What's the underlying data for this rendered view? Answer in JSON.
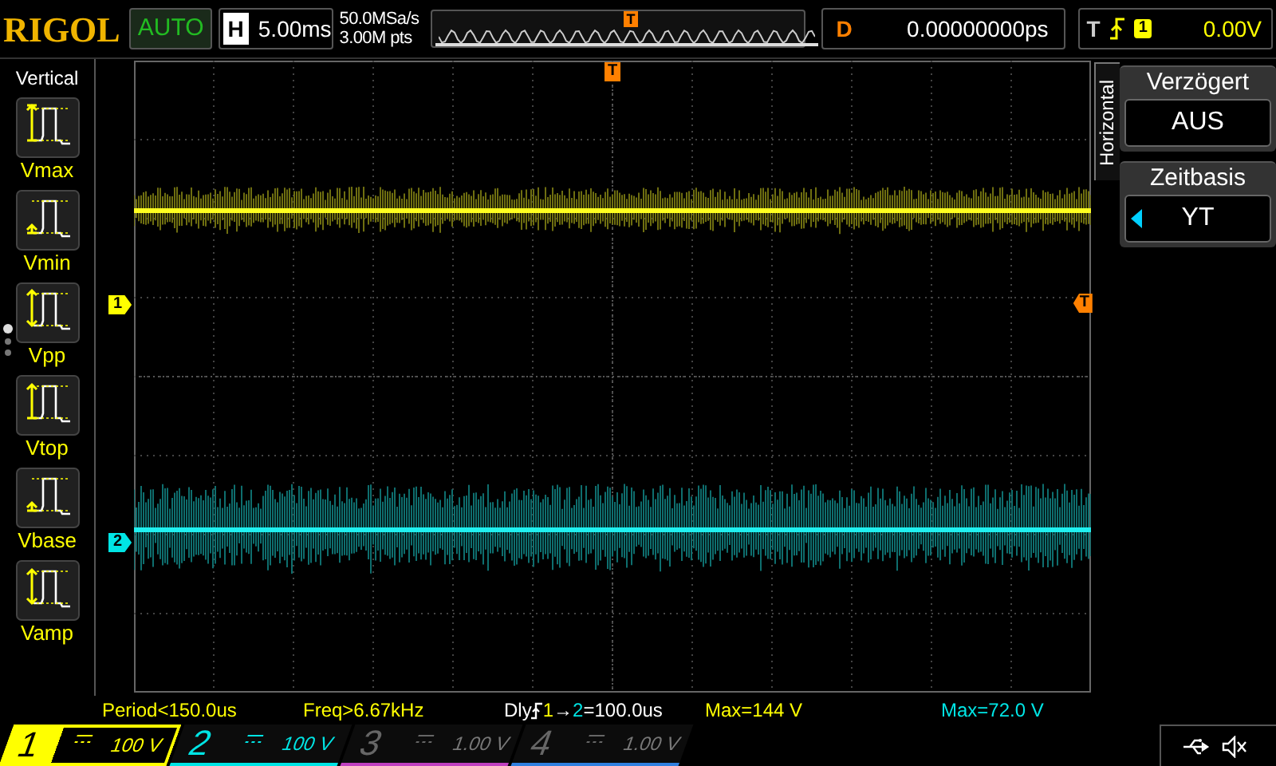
{
  "header": {
    "logo": "RIGOL",
    "run_state": "AUTO",
    "timebase_label": "H",
    "timebase": "5.00ms",
    "sample_rate": "50.0MSa/s",
    "memory_depth": "3.00M pts",
    "overview_trigger": "T",
    "delay_label": "D",
    "delay": "0.00000000ps",
    "trigger_label": "T",
    "trigger_source": "1",
    "trigger_level": "0.00V"
  },
  "left_menu": {
    "title": "Vertical",
    "items": [
      {
        "label": "Vmax"
      },
      {
        "label": "Vmin"
      },
      {
        "label": "Vpp"
      },
      {
        "label": "Vtop"
      },
      {
        "label": "Vbase"
      },
      {
        "label": "Vamp"
      }
    ]
  },
  "right_menu": {
    "title": "Horizontal",
    "items": [
      {
        "title": "Verzögert",
        "value": "AUS",
        "selected": false
      },
      {
        "title": "Zeitbasis",
        "value": "YT",
        "selected": true
      }
    ]
  },
  "screen": {
    "trigger_top": "T",
    "trigger_right": "T",
    "channel_markers": [
      {
        "label": "1",
        "color": "#ffff00"
      },
      {
        "label": "2",
        "color": "#00e5e5"
      }
    ]
  },
  "measurements": [
    {
      "kind": "text",
      "text": "Period<150.0us",
      "color": "#ffff00"
    },
    {
      "kind": "text",
      "text": "Freq>6.67kHz",
      "color": "#ffff00"
    },
    {
      "kind": "delay",
      "label": "Dly",
      "source": "1",
      "arrow": "→",
      "target": "2",
      "value": "=100.0us",
      "color": "#ffffff"
    },
    {
      "kind": "text",
      "text": "Max=144 V",
      "color": "#ffff00"
    },
    {
      "kind": "text",
      "text": "Max=72.0 V",
      "color": "#00e5e5"
    }
  ],
  "channels": [
    {
      "number": "1",
      "scale": "100 V",
      "color": "#ffff00",
      "on": true,
      "selected": true
    },
    {
      "number": "2",
      "scale": "100 V",
      "color": "#00e5e5",
      "on": true,
      "selected": false
    },
    {
      "number": "3",
      "scale": "1.00 V",
      "color": "#c040c0",
      "on": false,
      "selected": false
    },
    {
      "number": "4",
      "scale": "1.00 V",
      "color": "#3080e0",
      "on": false,
      "selected": false
    }
  ]
}
